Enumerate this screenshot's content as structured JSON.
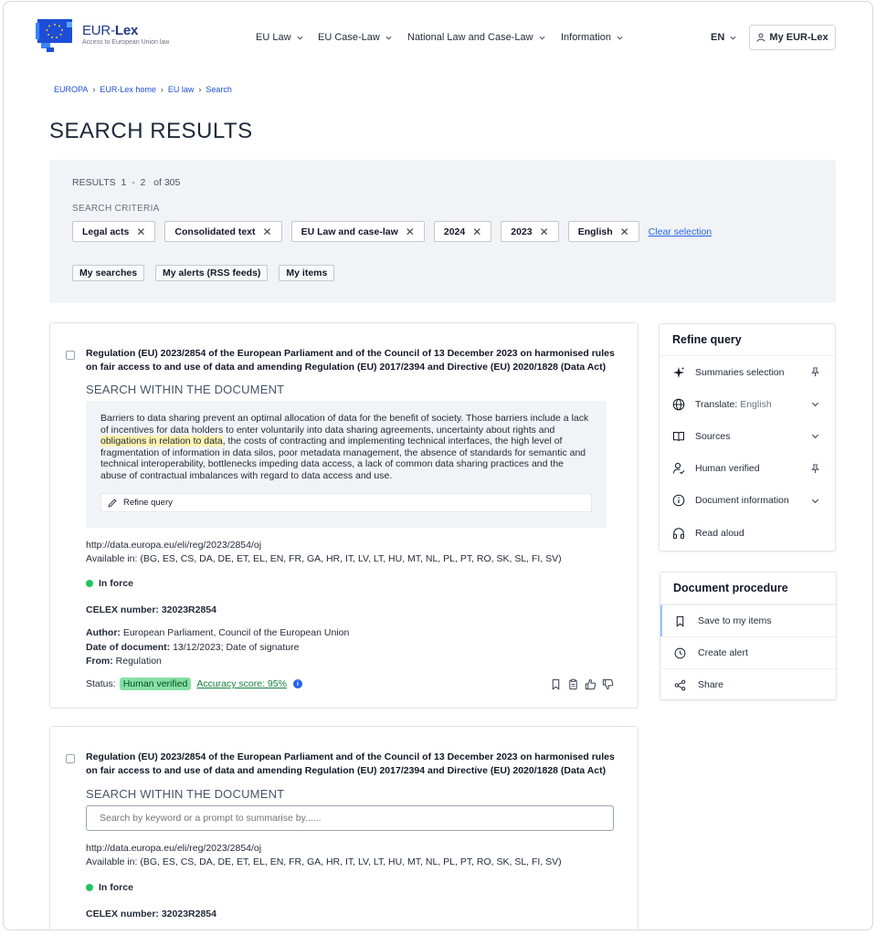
{
  "header": {
    "logo_title_plain": "EUR-",
    "logo_title_bold": "Lex",
    "logo_subtitle": "Access to European Union law",
    "nav": [
      "EU Law",
      "EU Case-Law",
      "National Law and Case-Law",
      "Information"
    ],
    "language": "EN",
    "account_label": "My EUR-Lex"
  },
  "breadcrumb": [
    "EUROPA",
    "EUR-Lex home",
    "EU law",
    "Search"
  ],
  "page_title": "SEARCH RESULTS",
  "criteria": {
    "results_label": "RESULTS",
    "results_from": "1",
    "results_dash": "-",
    "results_to": "2",
    "results_of": "of 305",
    "criteria_label": "SEARCH CRITERIA",
    "chips": [
      "Legal acts",
      "Consolidated text",
      "EU Law and case-law",
      "2024",
      "2023",
      "English"
    ],
    "clear_label": "Clear selection",
    "buttons": [
      "My searches",
      "My alerts (RSS feeds)",
      "My items"
    ]
  },
  "results": [
    {
      "title": "Regulation (EU) 2023/2854 of the European Parliament and of the Council of 13 December 2023 on harmonised rules on fair access to and use of data and amending Regulation (EU) 2017/2394 and Directive (EU) 2020/1828 (Data Act)",
      "search_within_label": "SEARCH WITHIN THE DOCUMENT",
      "excerpt_before": "Barriers to data sharing prevent an optimal allocation of data for the benefit of society. Those barriers include a lack of incentives for data holders to enter voluntarily into data sharing agreements, uncertainty about rights and ",
      "excerpt_highlight": "obligations in relation to data",
      "excerpt_after": ", the costs of contracting and implementing technical interfaces, the high level of fragmentation of information in data silos, poor metadata management, the absence of standards for semantic and technical interoperability, bottlenecks impeding data access, a lack of common data sharing practices and the abuse of contractual imbalances with regard to data access and use.",
      "refine_label": "Refine query",
      "url": "http://data.europa.eu/eli/reg/2023/2854/oj",
      "available": "Available in: (BG, ES, CS, DA, DE, ET, EL, EN, FR, GA, HR, IT, LV, LT, HU, MT, NL, PL, PT, RO, SK, SL, FI, SV)",
      "status_force": "In force",
      "celex": "CELEX number: 32023R2854",
      "author_label": "Author:",
      "author": "European Parliament, Council of the European Union",
      "date_label": "Date of document:",
      "date": "13/12/2023; Date of signature",
      "from_label": "From:",
      "from": "Regulation",
      "status_label": "Status:",
      "verified_badge": "Human verified",
      "accuracy": "Accuracy score: 95%"
    },
    {
      "title": "Regulation (EU) 2023/2854 of the European Parliament and of the Council of 13 December 2023 on harmonised rules on fair access to and use of data and amending Regulation (EU) 2017/2394 and Directive (EU) 2020/1828 (Data Act)",
      "search_within_label": "SEARCH WITHIN THE DOCUMENT",
      "search_placeholder": "Search by keyword or a prompt to summarise by......",
      "url": "http://data.europa.eu/eli/reg/2023/2854/oj",
      "available": "Available in: (BG, ES, CS, DA, DE, ET, EL, EN, FR, GA, HR, IT, LV, LT, HU, MT, NL, PL, PT, RO, SK, SL, FI, SV)",
      "status_force": "In force",
      "celex": "CELEX number: 32023R2854"
    }
  ],
  "refine_panel": {
    "title": "Refine query",
    "items": [
      {
        "label": "Summaries selection",
        "icon": "sparkle-icon",
        "trail": "pin-icon"
      },
      {
        "label": "Translate:",
        "extra": "English",
        "icon": "globe-icon",
        "trail": "chevron-down-icon"
      },
      {
        "label": "Sources",
        "icon": "book-icon",
        "trail": "chevron-down-icon"
      },
      {
        "label": "Human verified",
        "icon": "user-check-icon",
        "trail": "pin-icon"
      },
      {
        "label": "Document information",
        "icon": "info-icon",
        "trail": "chevron-down-icon"
      },
      {
        "label": "Read aloud",
        "icon": "headphones-icon"
      }
    ]
  },
  "procedure_panel": {
    "title": "Document procedure",
    "items": [
      {
        "label": "Save to my items",
        "icon": "bookmark-icon"
      },
      {
        "label": "Create alert",
        "icon": "clock-icon"
      },
      {
        "label": "Share",
        "icon": "share-icon"
      }
    ]
  },
  "colors": {
    "brand_blue": "#1f3a8a",
    "link_blue": "#2563eb",
    "in_force_green": "#22c55e",
    "verified_badge": "#86e0a4",
    "panel_bg": "#f1f3f6"
  }
}
